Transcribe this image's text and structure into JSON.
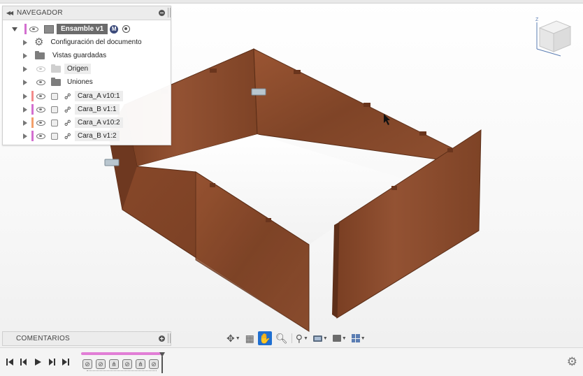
{
  "navigator": {
    "title": "NAVEGADOR",
    "root": {
      "label": "Ensamble v1",
      "badge": "M"
    },
    "items": [
      {
        "label": "Configuración del documento",
        "icon": "gear-icon"
      },
      {
        "label": "Vistas guardadas",
        "icon": "folder-icon"
      },
      {
        "label": "Origen",
        "icon": "folder-icon"
      },
      {
        "label": "Uniones",
        "icon": "folder-icon"
      },
      {
        "label": "Cara_A v10:1",
        "icon": "component-icon",
        "color": "#f28b8b"
      },
      {
        "label": "Cara_B v1:1",
        "icon": "component-icon",
        "color": "#d36fd0"
      },
      {
        "label": "Cara_A v10:2",
        "icon": "component-icon",
        "color": "#f2a06b"
      },
      {
        "label": "Cara_B v1:2",
        "icon": "component-icon",
        "color": "#d36fd0"
      }
    ]
  },
  "comments": {
    "title": "COMENTARIOS"
  },
  "viewcube": {
    "axis": "Z"
  },
  "colors": {
    "accent": "#1f6fd1",
    "wood": "#8a4a2c",
    "timeline_bar": "#e27ed6"
  },
  "nav_toolbar": {
    "icons": [
      "orbit-icon",
      "look-at-icon",
      "pan-icon",
      "zoom-icon",
      "zoom-window-icon",
      "display-settings-icon",
      "visual-style-icon",
      "viewports-icon"
    ],
    "active": "pan-icon"
  },
  "timeline": {
    "controls": [
      "go-to-start-icon",
      "step-back-icon",
      "play-icon",
      "step-forward-icon",
      "go-to-end-icon"
    ],
    "features": 6
  }
}
